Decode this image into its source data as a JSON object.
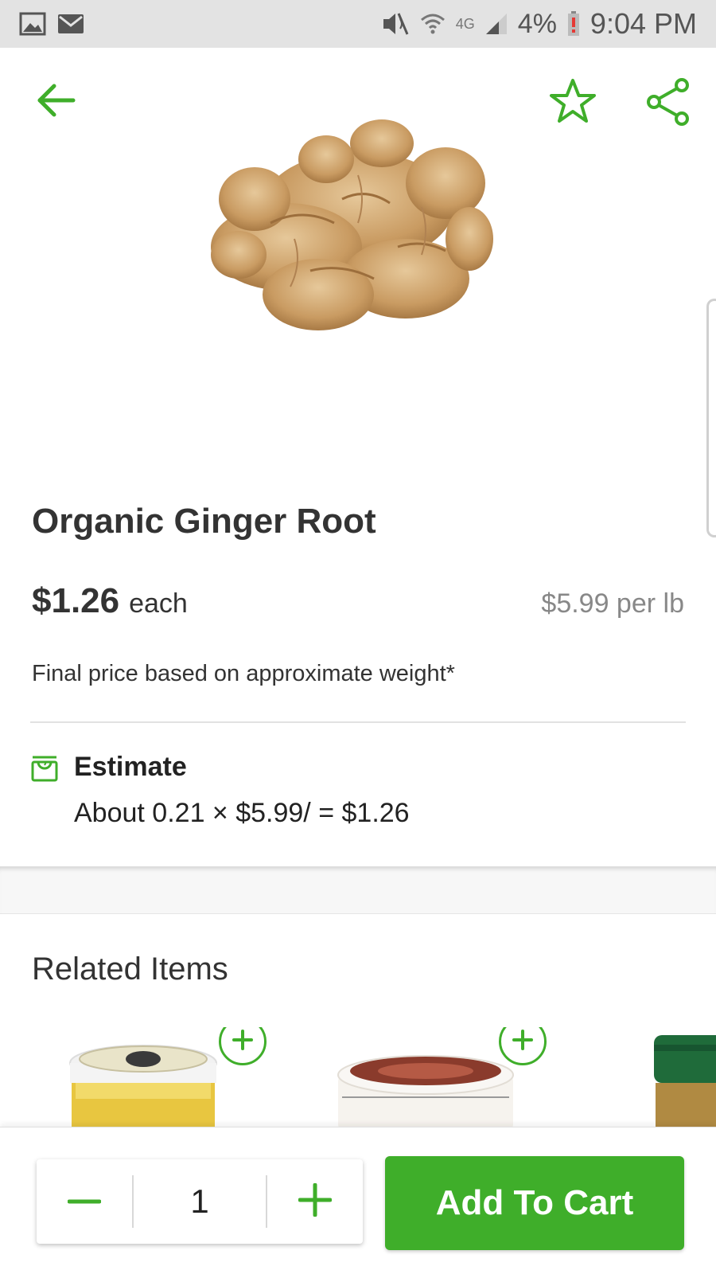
{
  "status_bar": {
    "battery": "4%",
    "time": "9:04 PM",
    "network": "4G"
  },
  "product": {
    "title": "Organic Ginger Root",
    "price": "$1.26",
    "price_unit": "each",
    "price_per": "$5.99 per lb",
    "price_note": "Final price based on approximate weight*"
  },
  "estimate": {
    "title": "Estimate",
    "calc": "About 0.21  × $5.99/ = $1.26"
  },
  "related": {
    "title": "Related Items"
  },
  "cart": {
    "quantity": "1",
    "add_label": "Add To Cart"
  },
  "colors": {
    "accent": "#3fae2a",
    "status_bar": "#e3e3e3",
    "text": "#333333",
    "muted": "#888888"
  },
  "icons": [
    "image-icon",
    "mail-icon",
    "mute-icon",
    "wifi-icon",
    "signal-icon",
    "battery-icon",
    "back-arrow-icon",
    "star-icon",
    "share-icon",
    "scale-icon",
    "plus-circle-icon",
    "minus-icon",
    "plus-icon"
  ]
}
